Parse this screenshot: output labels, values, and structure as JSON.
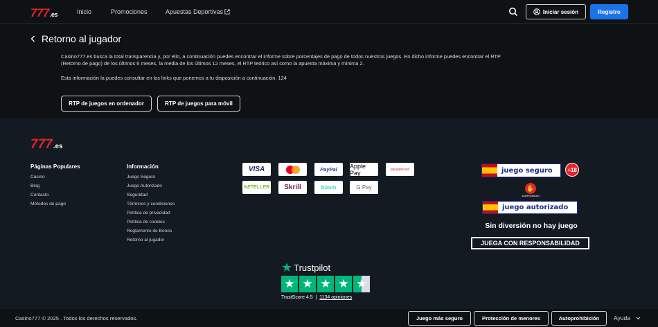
{
  "header": {
    "logo_main": "777",
    "logo_suffix": ".es",
    "nav": [
      "Inicio",
      "Promociones",
      "Apuestas Deportivas"
    ],
    "login_label": "Iniciar sesión",
    "register_label": "Registro"
  },
  "main": {
    "back_title": "Retorno al jugador",
    "para1_line1": "Casino777.es busca la total transparencia y, por ello, a continuación puedes encontrar el informe sobre porcentajes de pago de todos nuestros juegos. En dicho informe puedes encontrar el RTP",
    "para1_line2": "(Retorno de pago) de los últimos 6 meses, la media de los últimos 12 meses, el RTP teórico así como la apuesta máxima y mínima 2.",
    "para2": "Esta información la puedes consultar en los links que ponemos a tu disposición a continuación. 124",
    "btn_desktop": "RTP de juegos en ordenador",
    "btn_mobile": "RTP de juegos para móvil"
  },
  "footer": {
    "logo_main": "777",
    "logo_suffix": ".es",
    "popular_title": "Páginas Populares",
    "popular_links": [
      "Casino",
      "Blog",
      "Contacto",
      "Métodos de pago"
    ],
    "info_title": "Información",
    "info_links": [
      "Juego Seguro",
      "Juego Autorizado",
      "Seguridad",
      "Términos y condiciones",
      "Política de privacidad",
      "Política de cookies",
      "Reglamento de Bonos",
      "Retorno al jugador"
    ],
    "payments": [
      "VISA",
      "mastercard",
      "PayPal",
      "Apple Pay",
      "paysafecard",
      "NETELLER",
      "Skrill",
      "bizum",
      "G Pay"
    ],
    "juego_seguro": "juego seguro",
    "plus18": "+18",
    "autoprohibicion": "AutoProhibición",
    "juego_autorizado": "juego autorizado",
    "sin_diversion": "Sin diversión no hay juego",
    "juega_resp": "JUEGA CON RESPONSABILIDAD",
    "trustpilot_name": "Trustpilot",
    "trustscore_label": "TrustScore 4.5",
    "trustscore_reviews": "1134 opiniones",
    "trust_rating": 4.5
  },
  "bottom": {
    "copyright": "Casino777 © 2025 . Todos los derechos reservados.",
    "btn_juego": "Juego más seguro",
    "btn_menores": "Protección de menores",
    "btn_autoprohib": "Autoprohibición",
    "help": "Ayuda"
  }
}
